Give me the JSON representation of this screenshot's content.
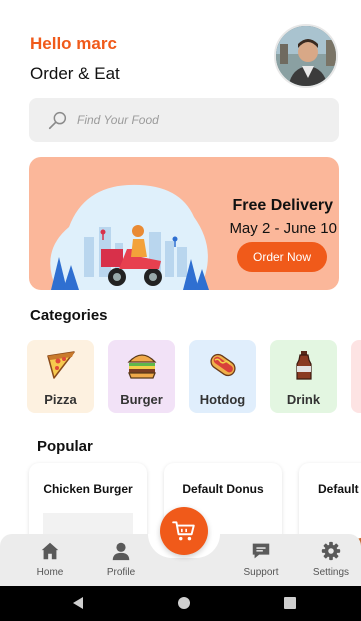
{
  "header": {
    "greeting": "Hello marc",
    "subtitle": "Order & Eat"
  },
  "search": {
    "placeholder": "Find Your Food"
  },
  "promo": {
    "title": "Free Delivery",
    "dates": "May 2 - June 10",
    "button_label": "Order Now"
  },
  "categories": {
    "title": "Categories",
    "items": [
      {
        "label": "Pizza",
        "icon": "pizza-icon",
        "bg": "#fdf1e0"
      },
      {
        "label": "Burger",
        "icon": "burger-icon",
        "bg": "#f2e2f7"
      },
      {
        "label": "Hotdog",
        "icon": "hotdog-icon",
        "bg": "#e0eefc"
      },
      {
        "label": "Drink",
        "icon": "drink-icon",
        "bg": "#e3f6e1"
      }
    ]
  },
  "popular": {
    "title": "Popular",
    "items": [
      {
        "name": "Chicken Burger"
      },
      {
        "name": "Default Donus"
      },
      {
        "name": "Default"
      }
    ]
  },
  "nav": {
    "items": [
      {
        "label": "Home",
        "icon": "home-icon"
      },
      {
        "label": "Profile",
        "icon": "profile-icon"
      },
      {
        "label": "Support",
        "icon": "support-icon"
      },
      {
        "label": "Settings",
        "icon": "settings-icon"
      }
    ],
    "cart_icon": "cart-icon"
  },
  "colors": {
    "accent": "#f05a1a",
    "banner_bg": "#fbb79a",
    "nav_bg": "#ececec"
  }
}
